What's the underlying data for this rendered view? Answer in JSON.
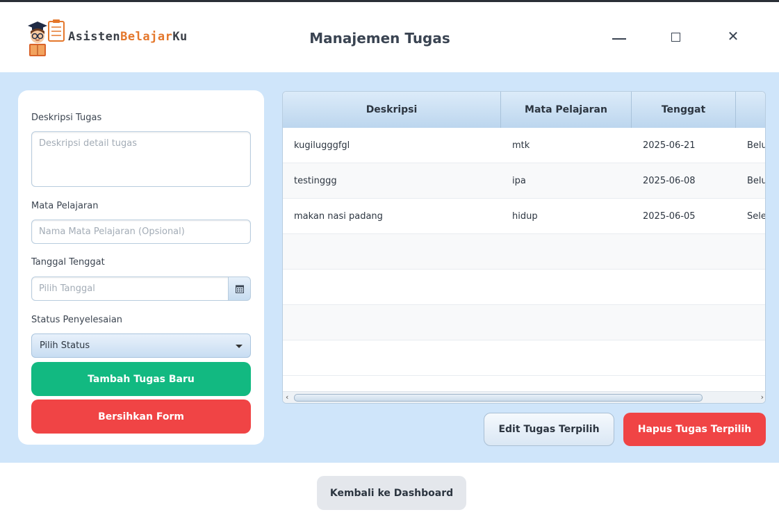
{
  "app": {
    "logo_part1": "Asisten",
    "logo_part2": "Belajar",
    "logo_part3": "Ku",
    "title": "Manajemen Tugas"
  },
  "window_controls": {
    "minimize_icon": "minimize-icon",
    "maximize_icon": "maximize-icon",
    "close_icon": "close-icon",
    "close_glyph": "✕"
  },
  "form": {
    "description_label": "Deskripsi Tugas",
    "description_placeholder": "Deskripsi detail tugas",
    "subject_label": "Mata Pelajaran",
    "subject_placeholder": "Nama Mata Pelajaran (Opsional)",
    "due_label": "Tanggal Tenggat",
    "due_placeholder": "Pilih Tanggal",
    "status_label": "Status Penyelesaian",
    "status_selected": "Pilih Status",
    "add_button": "Tambah Tugas Baru",
    "clear_button": "Bersihkan Form"
  },
  "table": {
    "columns": [
      "Deskripsi",
      "Mata Pelajaran",
      "Tenggat",
      ""
    ],
    "rows": [
      [
        "kugilugggfgl",
        "mtk",
        "2025-06-21",
        "Belu"
      ],
      [
        "testinggg",
        "ipa",
        "2025-06-08",
        "Belu"
      ],
      [
        "makan nasi padang",
        "hidup",
        "2025-06-05",
        "Sele"
      ]
    ]
  },
  "actions": {
    "edit_button": "Edit Tugas Terpilih",
    "delete_button": "Hapus Tugas Terpilih",
    "back_button": "Kembali ke Dashboard"
  },
  "colors": {
    "accent_green": "#12b981",
    "accent_red": "#f04445",
    "background_blue": "#cfe5fa"
  }
}
